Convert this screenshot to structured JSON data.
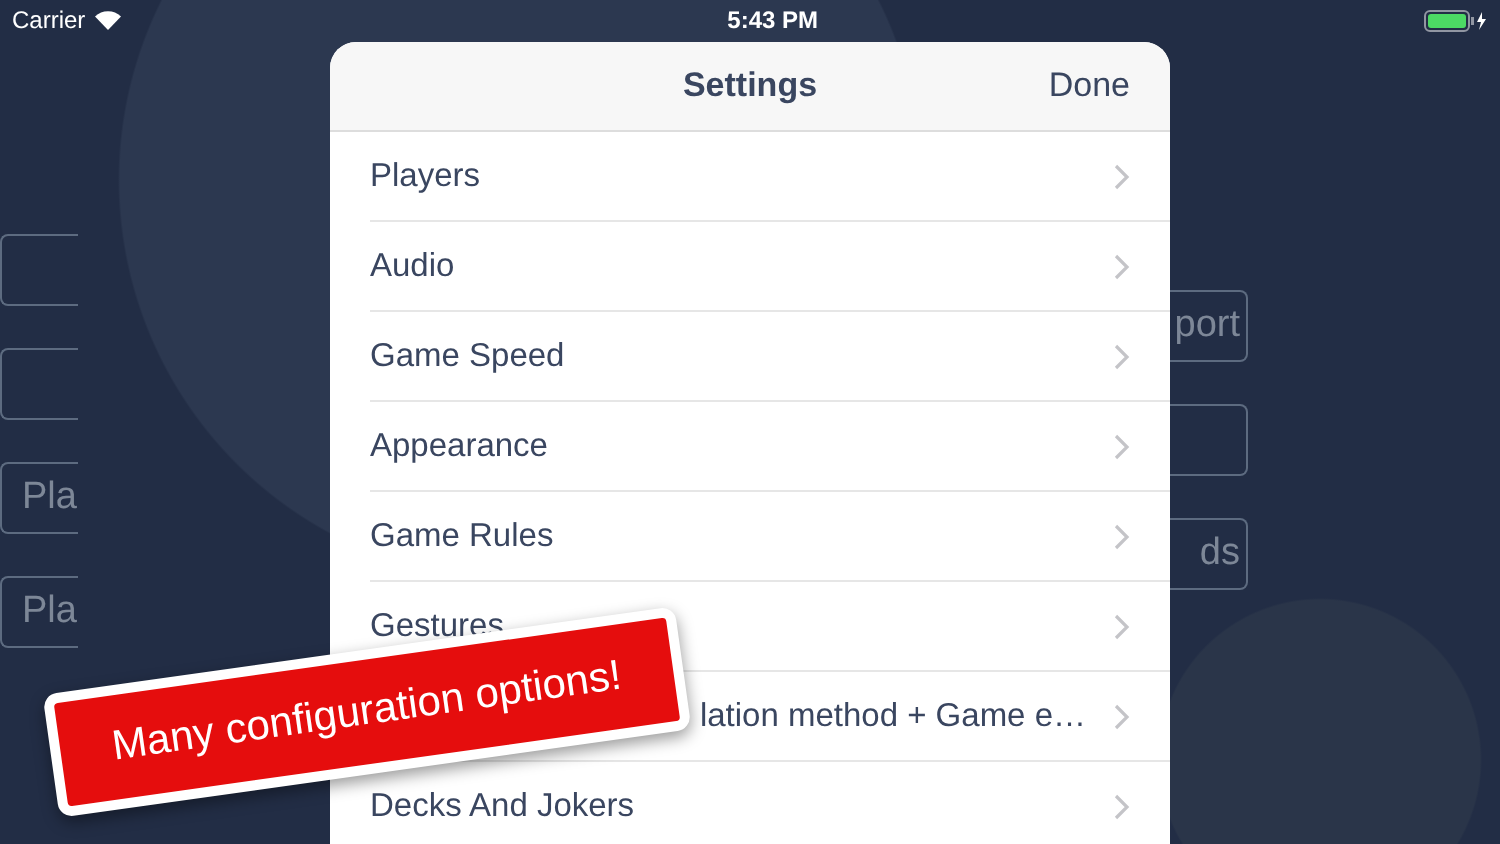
{
  "status_bar": {
    "carrier": "Carrier",
    "time": "5:43 PM"
  },
  "background_buttons_left": [
    {
      "kind": "blank"
    },
    {
      "kind": "blank"
    },
    {
      "kind": "text",
      "label": "Pla"
    },
    {
      "kind": "text",
      "label": "Pla"
    }
  ],
  "background_buttons_right": [
    {
      "kind": "text",
      "label": "port"
    },
    {
      "kind": "blank"
    },
    {
      "kind": "text",
      "label": "ds"
    }
  ],
  "settings": {
    "title": "Settings",
    "done": "Done",
    "items": [
      {
        "kind": "plain",
        "label": "Players"
      },
      {
        "kind": "plain",
        "label": "Audio"
      },
      {
        "kind": "plain",
        "label": "Game Speed"
      },
      {
        "kind": "plain",
        "label": "Appearance"
      },
      {
        "kind": "plain",
        "label": "Game Rules"
      },
      {
        "kind": "plain",
        "label": "Gestures"
      },
      {
        "kind": "covered",
        "label": "lation method + Game e…"
      },
      {
        "kind": "plain",
        "label": "Decks And Jokers"
      }
    ]
  },
  "banner": {
    "text": "Many configuration options!"
  }
}
